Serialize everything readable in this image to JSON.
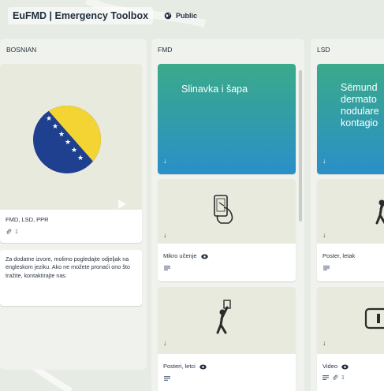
{
  "header": {
    "board_title": "EuFMD | Emergency Toolbox",
    "visibility": "Public"
  },
  "lists": {
    "bosnian": {
      "title": "BOSNIAN",
      "card1": {
        "title": "FMD, LSD, PPR",
        "attachments": "1"
      },
      "card2": {
        "description": "Za dodatne izvore, molimo pogledajte odjeljak na engleskom jeziku. Ako ne možete pronaći ono što tražite, kontaktirajte nas."
      }
    },
    "fmd": {
      "title": "FMD",
      "card1": {
        "cover_text": "Slinavka i šapa"
      },
      "card2": {
        "title": "Mikro učenje"
      },
      "card3": {
        "title": "Posteri, letci"
      }
    },
    "lsd": {
      "title": "LSD",
      "card1": {
        "cover_text": "Sëmund dermato nodulare kontagio"
      },
      "card2": {
        "title": "Poster, letak"
      },
      "card3": {
        "title": "Video",
        "attachments": "1"
      }
    }
  },
  "colors": {
    "fmd_gradient_top": "#3aaa8a",
    "fmd_gradient_bottom": "#2a8fc8",
    "cover_beige": "#e9eade",
    "flag_blue": "#1f3f8f",
    "flag_yellow": "#f3d432"
  },
  "icons": [
    "globe-icon",
    "attachment-icon",
    "download-icon",
    "eye-icon",
    "description-icon"
  ]
}
